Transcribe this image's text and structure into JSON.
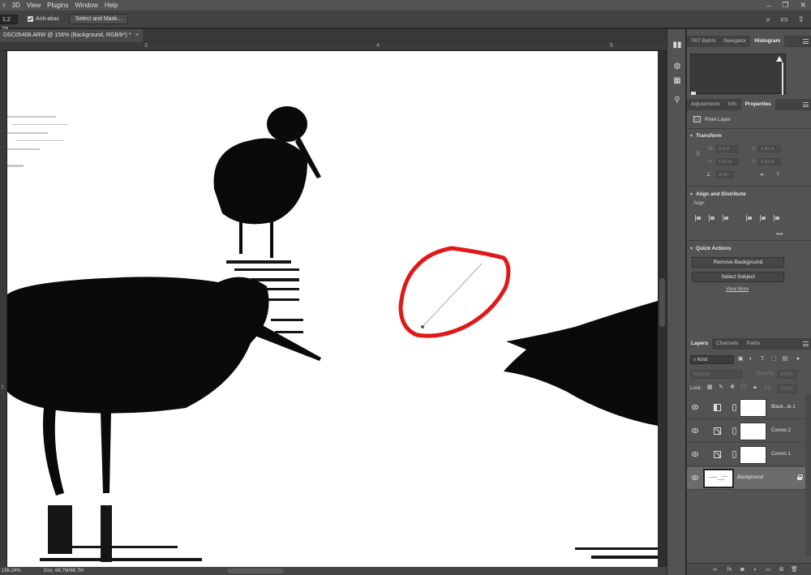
{
  "menu": [
    "r",
    "3D",
    "View",
    "Plugins",
    "Window",
    "Help"
  ],
  "options": {
    "feather_value": "1.2 px",
    "anti_alias_label": "Anti-alias",
    "select_mask_label": "Select and Mask..."
  },
  "document": {
    "tab_title": "DSC05408.ARW @ 156% (Background, RGB/8*) *",
    "close_glyph": "×",
    "ruler_numbers": [
      "3",
      "4",
      "5"
    ],
    "ruler_left_number": "7"
  },
  "status": {
    "zoom": "156.24%",
    "doc_size": "Doc: 68.7M/68.7M"
  },
  "panels": {
    "top_tabs": [
      "TK7 Batch",
      "Navigator",
      "Histogram"
    ],
    "mid_tabs": [
      "Adjustments",
      "Info",
      "Properties"
    ],
    "layer_type": "Pixel Layer",
    "transform": {
      "title": "Transform",
      "w_label": "W",
      "h_label": "H",
      "x_label": "X",
      "y_label": "Y",
      "w_value": "0.3 in",
      "h_value": "1.47 in",
      "x_value": "7.41 in",
      "y_value": "3.23 in",
      "angle_value": "0.00°"
    },
    "align": {
      "title": "Align and Distribute",
      "label": "Align:",
      "more": "•••"
    },
    "quick_actions": {
      "title": "Quick Actions",
      "remove_bg": "Remove Background",
      "select_subject": "Select Subject",
      "view_more": "View More"
    }
  },
  "layers_panel": {
    "tabs": [
      "Layers",
      "Channels",
      "Paths"
    ],
    "filter": "Kind",
    "blend_mode": "Normal",
    "opacity_label": "Opacity:",
    "opacity_value": "100%",
    "lock_label": "Lock:",
    "fill_label": "Fill:",
    "fill_value": "100%",
    "layers": [
      {
        "name": "Black...te 1"
      },
      {
        "name": "Curves 2"
      },
      {
        "name": "Curves 1"
      },
      {
        "name": "Background"
      }
    ]
  },
  "colors": {
    "annotation_circle": "#e01818",
    "selected_tab_bg": "#535353",
    "canvas_bg": "#ffffff"
  }
}
